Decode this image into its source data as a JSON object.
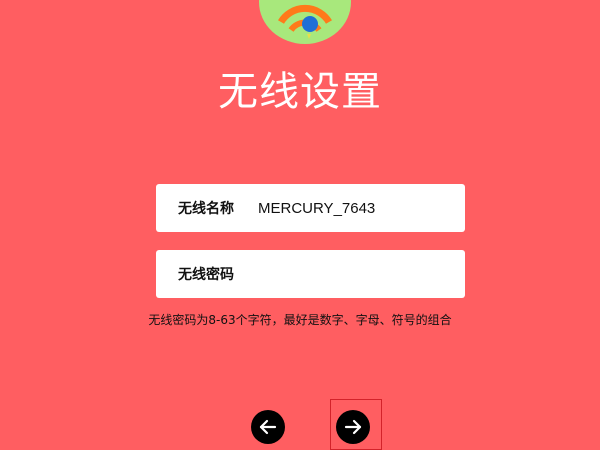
{
  "page": {
    "title": "无线设置",
    "logo_icon": "wifi-router-logo-icon"
  },
  "wireless_name": {
    "label": "无线名称",
    "value": "MERCURY_7643"
  },
  "wireless_password": {
    "label": "无线密码",
    "value": "",
    "placeholder": ""
  },
  "hint": "无线密码为8-63个字符，最好是数字、字母、符号的组合",
  "navigation": {
    "back_icon": "arrow-left-icon",
    "next_icon": "arrow-right-icon"
  },
  "colors": {
    "background": "#ff5e61",
    "logo_circle": "#a8e87c",
    "wifi_arc_orange": "#ff7a1a",
    "wifi_dot_blue": "#1f6fd6",
    "button": "#000000",
    "focus_outline": "#d3232a"
  }
}
